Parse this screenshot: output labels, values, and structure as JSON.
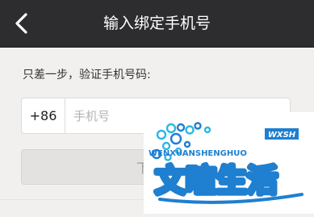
{
  "navbar": {
    "back_icon": "chevron-left-icon",
    "title": "输入绑定手机号"
  },
  "form": {
    "instruction": "只差一步，验证手机号码:",
    "country_code": "+86",
    "phone_placeholder": "手机号",
    "next_button_label": "下一步"
  },
  "watermark": {
    "latin_text": "WENXUANSHENGHUO",
    "badge_text": "WXSH",
    "brand_text": "文暄生活"
  },
  "colors": {
    "navbar": "#2d2d30",
    "background": "#f1f0ee",
    "button_disabled": "#e3e2e0",
    "watermark_blue": "#1f7fd0",
    "watermark_cyan": "#2fb6e3"
  }
}
